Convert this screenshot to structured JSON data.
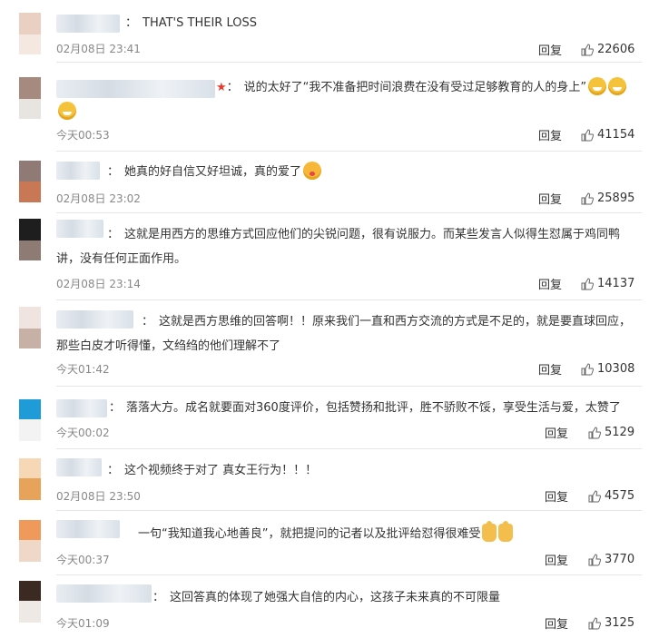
{
  "reply_label": "回复",
  "comments": [
    {
      "text": "THAT'S THEIR LOSS",
      "time": "02月08日 23:41",
      "likes": "22606"
    },
    {
      "text": "说的太好了“我不准备把时间浪费在没有受过足够教育的人的身上”",
      "time": "今天00:53",
      "likes": "41154"
    },
    {
      "text": "她真的好自信又好坦诚，真的爱了",
      "time": "02月08日 23:02",
      "likes": "25895"
    },
    {
      "text": "这就是用西方的思维方式回应他们的尖锐问题，很有说服力。而某些发言人似得生怼属于鸡同鸭讲，没有任何正面作用。",
      "time": "02月08日 23:14",
      "likes": "14137"
    },
    {
      "text": "这就是西方思维的回答啊！！原来我们一直和西方交流的方式是不足的，就是要直球回应，那些白皮才听得懂，文绉绉的他们理解不了",
      "time": "今天01:42",
      "likes": "10308"
    },
    {
      "text": "落落大方。成名就要面对360度评价，包括赞扬和批评，胜不骄败不馁，享受生活与爱，太赞了",
      "time": "今天00:02",
      "likes": "5129"
    },
    {
      "text": "这个视频终于对了 真女王行为！！！",
      "time": "02月08日 23:50",
      "likes": "4575"
    },
    {
      "text": "一句“我知道我心地善良”，就把提问的记者以及批评给怼得很难受",
      "time": "今天00:37",
      "likes": "3770"
    },
    {
      "text": "这回答真的体现了她强大自信的内心，这孩子未来真的不可限量",
      "time": "今天01:09",
      "likes": "3125"
    }
  ],
  "colors": {
    "divider": "#e6e6e6",
    "text": "#333333",
    "meta": "#888888",
    "star": "#e8392c"
  }
}
